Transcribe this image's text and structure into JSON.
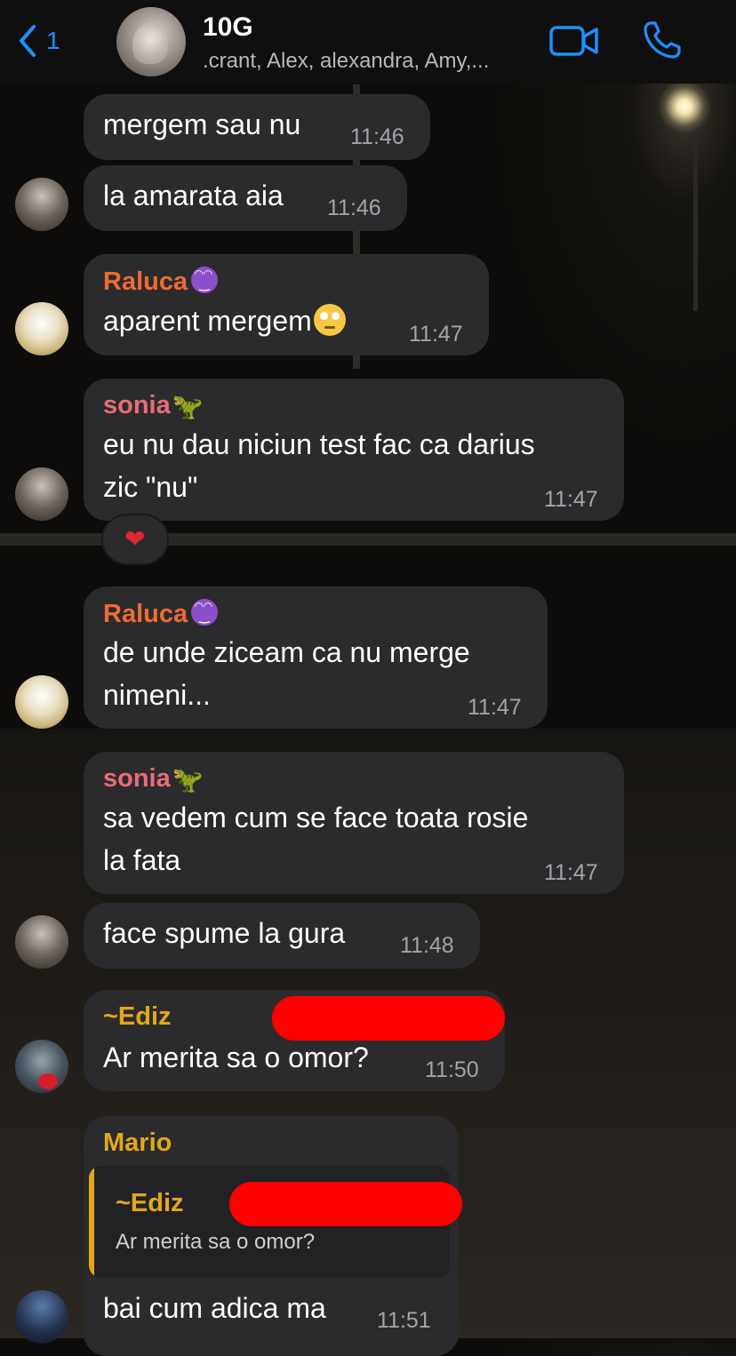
{
  "header": {
    "back_count": "1",
    "title": "10G",
    "members": ".crant, Alex, alexandra, Amy,..."
  },
  "colors": {
    "accent": "#1f8fff",
    "raluca": "#ee6b33",
    "sonia": "#e86c76",
    "ediz": "#e3a71a",
    "mario": "#e3a71a",
    "redaction": "#ff0000",
    "bubble": "#2b2b2d"
  },
  "messages": [
    {
      "text": "mergem sau nu",
      "time": "11:46"
    },
    {
      "text": "la amarata aia",
      "time": "11:46"
    },
    {
      "sender": "Raluca",
      "text": "aparent mergem",
      "time": "11:47"
    },
    {
      "sender": "sonia",
      "line1": "eu nu dau niciun test fac ca darius",
      "line2": "zic \"nu\"",
      "time": "11:47",
      "reaction": "heart"
    },
    {
      "sender": "Raluca",
      "line1": "de unde ziceam ca nu merge",
      "line2": "nimeni...",
      "time": "11:47"
    },
    {
      "sender": "sonia",
      "line1": "sa vedem cum se face toata rosie",
      "line2": "la fata",
      "time": "11:47"
    },
    {
      "text": "face spume la gura",
      "time": "11:48"
    },
    {
      "sender": "~Ediz",
      "text": "Ar merita sa o omor?",
      "time": "11:50"
    },
    {
      "sender": "Mario",
      "quote_sender": "~Ediz",
      "quote_text": "Ar merita sa o omor?",
      "text": "bai cum adica ma",
      "time": "11:51"
    }
  ]
}
